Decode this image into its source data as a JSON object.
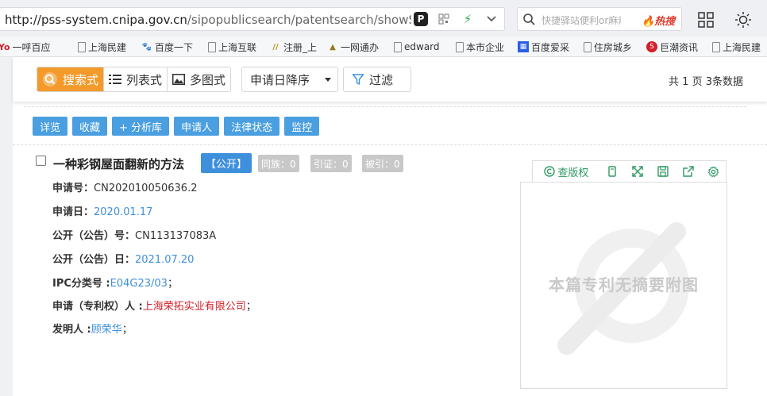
{
  "browser": {
    "url_main": "http://pss-system.cnipa.gov.cn",
    "url_rest": "/sipopublicsearch/patentsearch/showSearchRe",
    "search_placeholder": "快捷驿站便利or麻烦",
    "search_hot": "🔥热搜",
    "bookmarks": [
      {
        "label": "一呼百应",
        "icon": "yo-icon"
      },
      {
        "label": "上海民建",
        "icon": "file-icon"
      },
      {
        "label": "百度一下",
        "icon": "baidu-paw-icon"
      },
      {
        "label": "上海互联",
        "icon": "file-icon"
      },
      {
        "label": "注册_上",
        "icon": "stripe-icon"
      },
      {
        "label": "一网通办",
        "icon": "mountain-icon"
      },
      {
        "label": "edward",
        "icon": "file-icon"
      },
      {
        "label": "本市企业",
        "icon": "file-icon"
      },
      {
        "label": "百度爱采",
        "icon": "baidu-square-icon"
      },
      {
        "label": "住房城乡",
        "icon": "file-icon"
      },
      {
        "label": "巨潮资讯",
        "icon": "red-s-icon"
      },
      {
        "label": "上海民建",
        "icon": "file-icon"
      }
    ]
  },
  "toolbar": {
    "views": [
      {
        "label": "搜索式",
        "icon": "search-style-icon",
        "active": true
      },
      {
        "label": "列表式",
        "icon": "list-icon",
        "active": false
      },
      {
        "label": "多图式",
        "icon": "image-icon",
        "active": false
      }
    ],
    "sort": "申请日降序",
    "filter": "过滤",
    "page_info": "共 1 页 3条数据"
  },
  "actions": [
    "详览",
    "收藏",
    "+ 分析库",
    "申请人",
    "法律状态",
    "监控"
  ],
  "result": {
    "title": "一种彩钢屋面翻新的方法",
    "status": "【公开】",
    "badges": [
      "同族：0",
      "引证：0",
      "被引：0"
    ],
    "fields": {
      "app_no_label": "申请号：",
      "app_no": "CN202010050636.2",
      "app_date_label": "申请日：",
      "app_date": "2020.01.17",
      "pub_no_label": "公开（公告）号：",
      "pub_no": "CN113137083A",
      "pub_date_label": "公开（公告）日：",
      "pub_date": "2021.07.20",
      "ipc_label": "IPC分类号 :",
      "ipc": "E04G23/03",
      "applicant_label": "申请（专利权）人 :",
      "applicant": "上海荣拓实业有限公司",
      "inventor_label": "发明人 :",
      "inventor": "顾荣华",
      "sep": "；"
    },
    "panel": {
      "copyright_label": "查版权",
      "no_image_text": "本篇专利无摘要附图"
    }
  },
  "colors": {
    "accent_orange": "#f39a2b",
    "action_blue": "#4a9fe0",
    "status_blue": "#3e8fdc",
    "link_red": "#d0202a",
    "panel_green": "#2f9a62"
  }
}
